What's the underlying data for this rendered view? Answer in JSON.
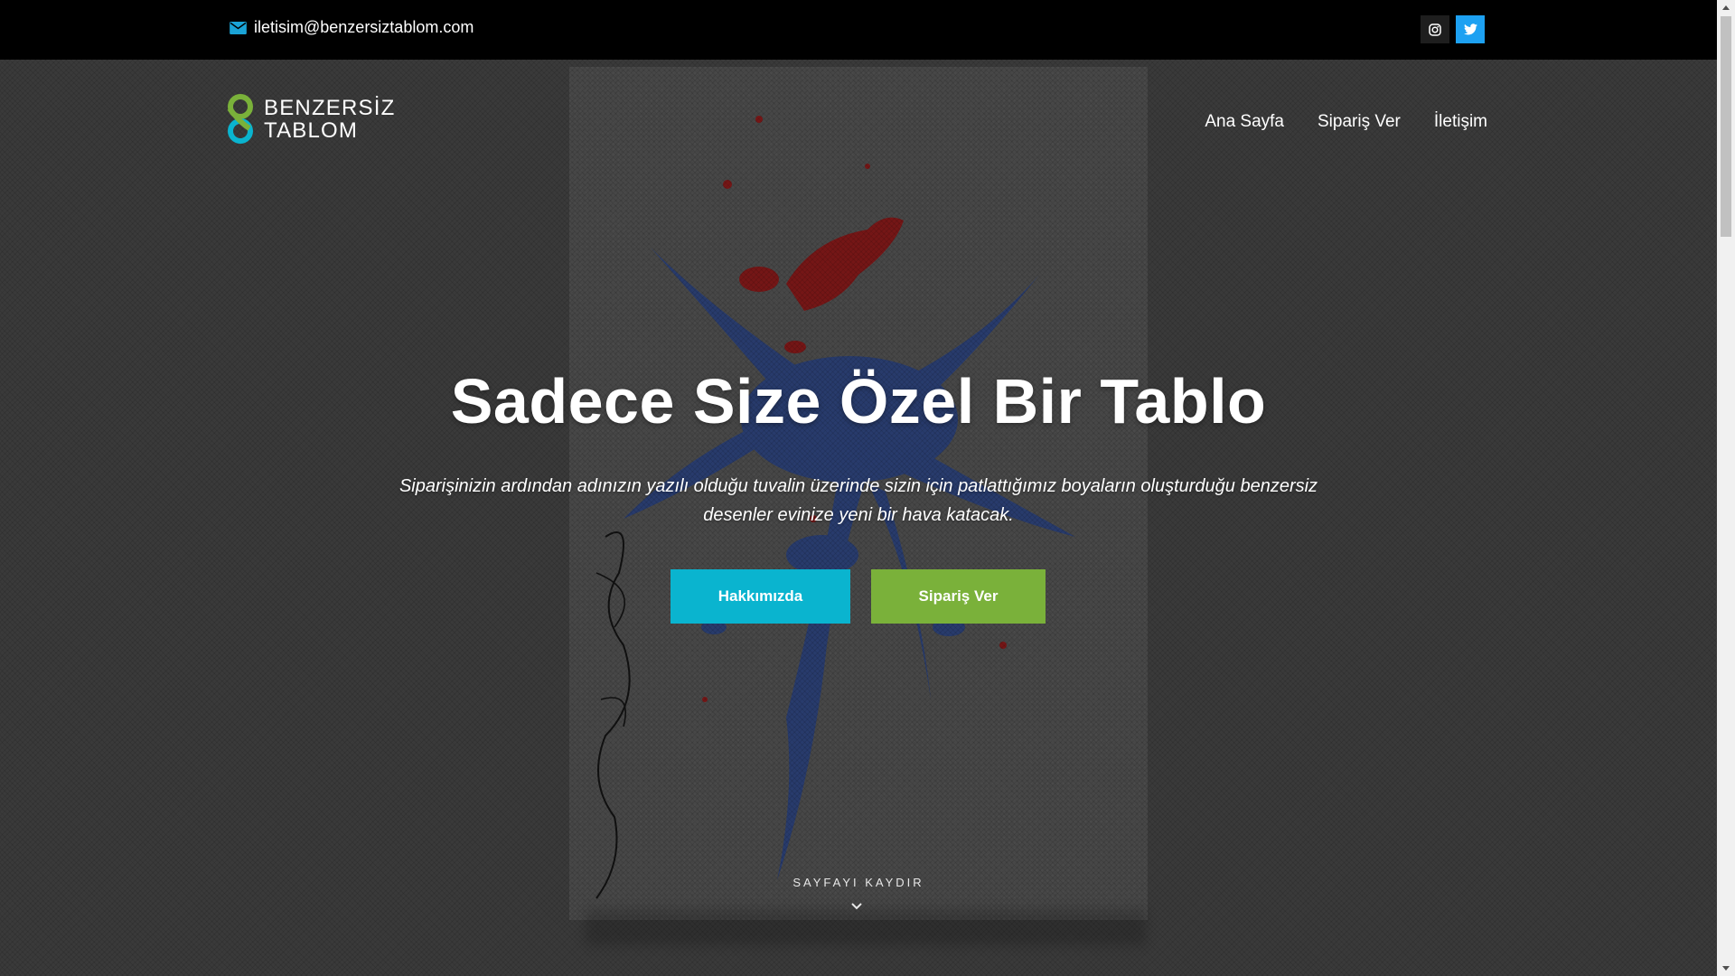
{
  "topbar": {
    "email": "iletisim@benzersiztablom.com",
    "email_icon": "envelope-icon",
    "social": [
      {
        "name": "instagram",
        "icon": "instagram-icon",
        "color": "#1e1e1e"
      },
      {
        "name": "twitter",
        "icon": "twitter-icon",
        "color": "#1da1f2"
      }
    ]
  },
  "logo": {
    "line1": "BENZERSİZ",
    "line2": "TABLOM",
    "colors": {
      "green": "#7ab13a",
      "teal": "#0ab4cf"
    }
  },
  "nav": {
    "items": [
      "Ana Sayfa",
      "Sipariş Ver",
      "İletişim"
    ]
  },
  "hero": {
    "title": "Sadece Size Özel Bir Tablo",
    "subtitle": "Siparişinizin ardından adınızın yazılı olduğu tuvalin üzerinde sizin için patlattığımız boyaların oluşturduğu benzersiz desenler evinize yeni bir hava katacak.",
    "buttons": {
      "about": "Hakkımızda",
      "order": "Sipariş Ver"
    },
    "scroll_hint": "SAYFAYI KAYDIR",
    "scroll_icon": "chevron-down-icon"
  },
  "colors": {
    "topbar_bg": "#000000",
    "accent_teal": "#0ab4cf",
    "accent_green": "#7ab13a",
    "twitter_blue": "#1da1f2"
  }
}
